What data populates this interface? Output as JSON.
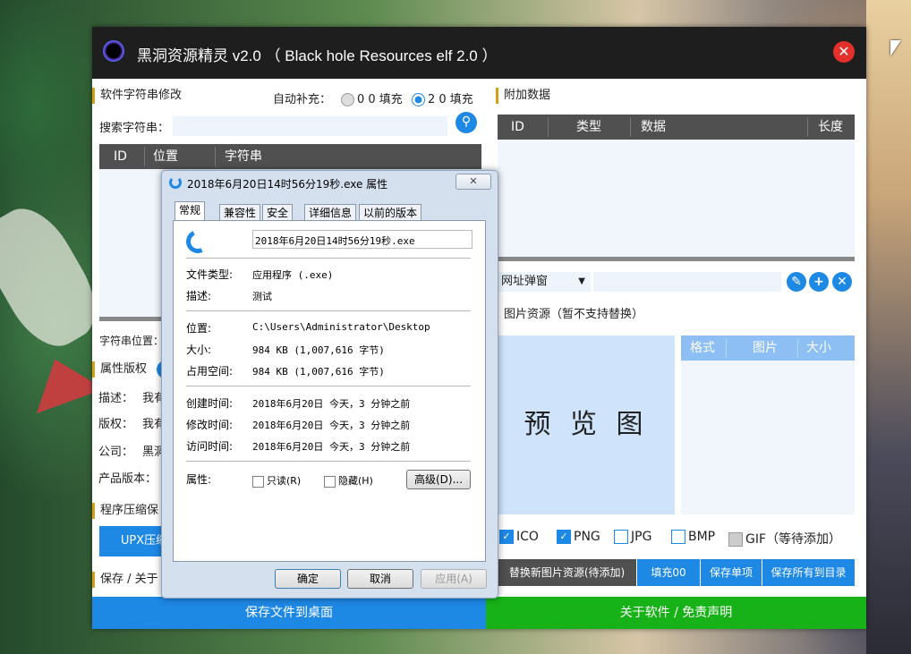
{
  "app": {
    "title": "黑洞资源精灵 v2.0 （ Black hole Resources elf 2.0 ）",
    "close_glyph": "✕"
  },
  "left": {
    "string_section": "软件字符串修改",
    "autofill_label": "自动补充：",
    "fill_options": [
      {
        "label": "0 0 填充",
        "selected": false
      },
      {
        "label": "2 0 填充",
        "selected": true
      }
    ],
    "search_label": "搜索字符串：",
    "search_value": "",
    "columns": [
      "ID",
      "位置",
      "字符串"
    ],
    "string_pos_label": "字符串位置：",
    "attr_section": "属性版权",
    "desc_label": "描述：",
    "desc_value": "我有",
    "copyright_label": "版权：",
    "copyright_value": "我有",
    "company_label": "公司：",
    "company_value": "黑洞",
    "product_label": "产品版本：",
    "compress_section": "程序压缩保",
    "upx_label": "UPX压缩",
    "save_section": "保存 / 关于"
  },
  "right": {
    "extra_section": "附加数据",
    "columns": [
      "ID",
      "类型",
      "数据",
      "长度"
    ],
    "dropdown_value": "网址弹窗",
    "image_section": "图片资源（暂不支持替换）",
    "preview_text": "预 览 图",
    "image_columns": [
      "格式",
      "图片",
      "大小"
    ],
    "formats": [
      {
        "label": "ICO",
        "checked": true
      },
      {
        "label": "PNG",
        "checked": true
      },
      {
        "label": "JPG",
        "checked": false
      },
      {
        "label": "BMP",
        "checked": false
      },
      {
        "label": "GIF（等待添加）",
        "checked": false,
        "disabled": true
      }
    ],
    "actions": [
      "替换新图片资源(待添加)",
      "填充00",
      "保存单项",
      "保存所有到目录"
    ]
  },
  "bottom": {
    "save_desktop": "保存文件到桌面",
    "about": "关于软件 / 免责声明"
  },
  "dialog": {
    "title": "2018年6月20日14时56分19秒.exe 属性",
    "close_glyph": "✕",
    "tabs": [
      "常规",
      "兼容性",
      "安全",
      "详细信息",
      "以前的版本"
    ],
    "filename": "2018年6月20日14时56分19秒.exe",
    "rows": [
      {
        "label": "文件类型:",
        "value": "应用程序 (.exe)"
      },
      {
        "label": "描述:",
        "value": "测试"
      },
      {
        "label": "位置:",
        "value": "C:\\Users\\Administrator\\Desktop"
      },
      {
        "label": "大小:",
        "value": "984 KB (1,007,616 字节)"
      },
      {
        "label": "占用空间:",
        "value": "984 KB (1,007,616 字节)"
      },
      {
        "label": "创建时间:",
        "value": "2018年6月20日 今天，3 分钟之前"
      },
      {
        "label": "修改时间:",
        "value": "2018年6月20日 今天，3 分钟之前"
      },
      {
        "label": "访问时间:",
        "value": "2018年6月20日 今天，3 分钟之前"
      }
    ],
    "attr_label": "属性:",
    "readonly_label": "只读(R)",
    "hidden_label": "隐藏(H)",
    "advanced_label": "高级(D)...",
    "ok_label": "确定",
    "cancel_label": "取消",
    "apply_label": "应用(A)"
  }
}
